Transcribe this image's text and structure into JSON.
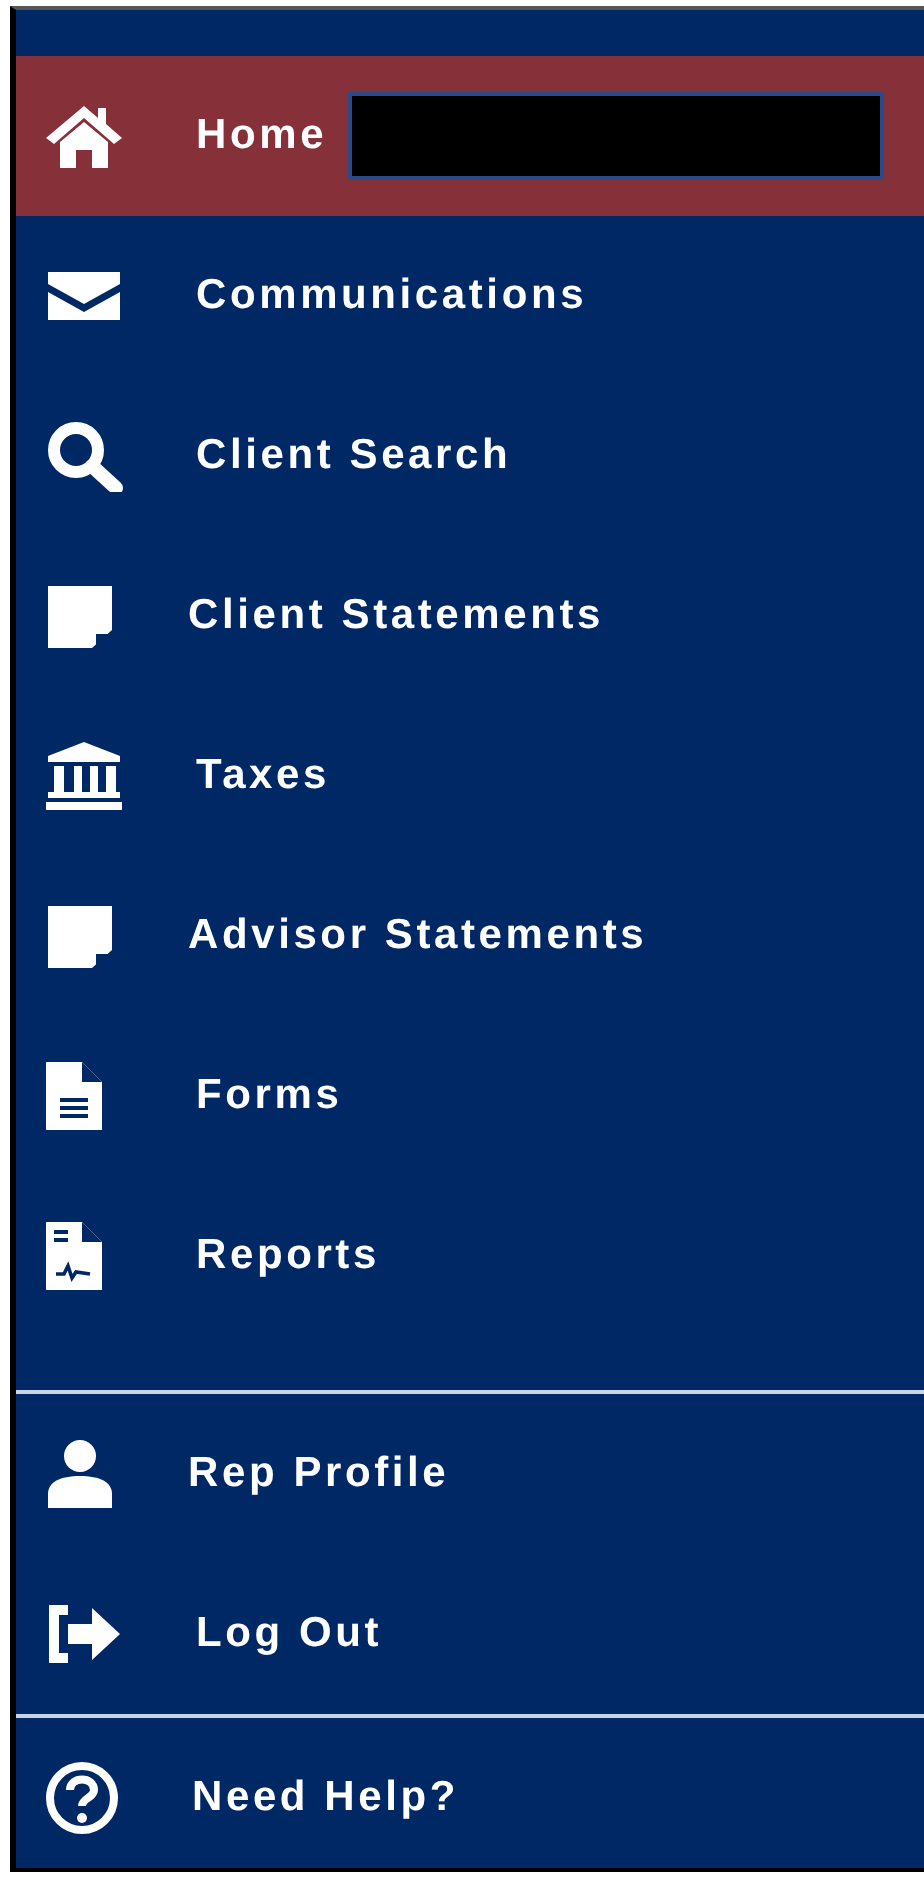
{
  "menu": {
    "items": [
      {
        "label": "Home",
        "kind": "home",
        "selected": true
      },
      {
        "label": "Communications",
        "kind": "envelope",
        "selected": false
      },
      {
        "label": "Client Search",
        "kind": "search",
        "selected": false
      },
      {
        "label": "Client Statements",
        "kind": "note",
        "selected": false
      },
      {
        "label": "Taxes",
        "kind": "bank",
        "selected": false
      },
      {
        "label": "Advisor Statements",
        "kind": "note",
        "selected": false
      },
      {
        "label": "Forms",
        "kind": "document",
        "selected": false
      },
      {
        "label": "Reports",
        "kind": "report",
        "selected": false
      }
    ]
  },
  "account": {
    "items": [
      {
        "label": "Rep Profile",
        "kind": "user",
        "selected": false
      },
      {
        "label": "Log Out",
        "kind": "logout",
        "selected": false
      }
    ]
  },
  "help": {
    "items": [
      {
        "label": "Need Help?",
        "kind": "help",
        "selected": false
      }
    ]
  }
}
